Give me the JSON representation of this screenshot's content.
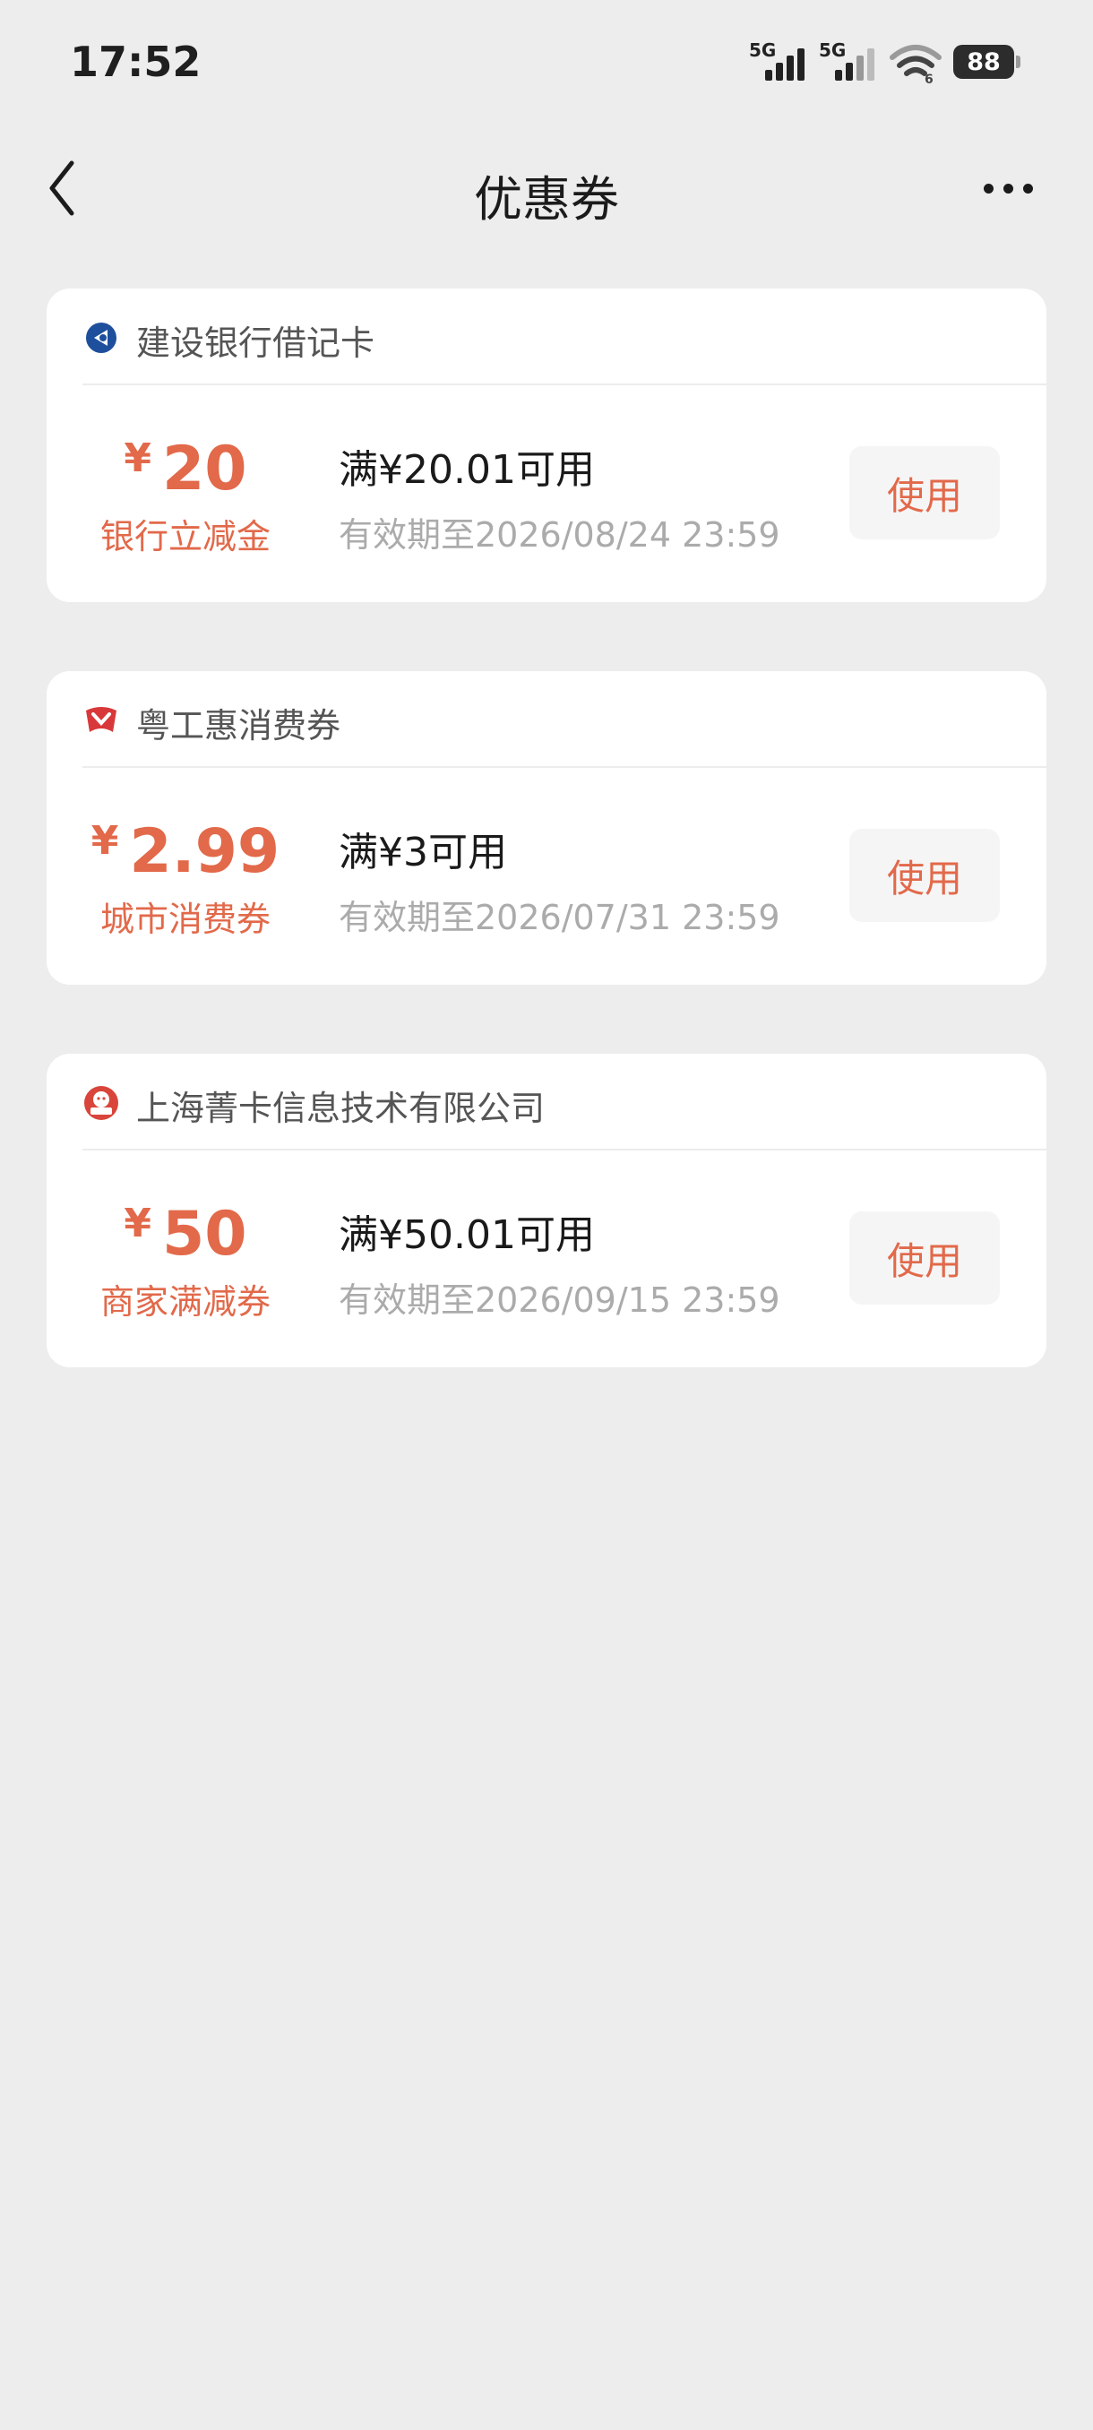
{
  "status_bar": {
    "time": "17:52",
    "signal_1_label": "5G",
    "signal_2_label": "5G",
    "battery": "88"
  },
  "nav": {
    "title": "优惠券",
    "back_icon": "chevron-left-icon",
    "more_icon": "more-horizontal-icon"
  },
  "colors": {
    "accent": "#e2694a",
    "background": "#ededed",
    "card": "#ffffff",
    "muted_text": "#ababab"
  },
  "coupons": [
    {
      "issuer": "建设银行借记卡",
      "issuer_icon": "ccb-logo-icon",
      "currency": "¥",
      "amount": "20",
      "type": "银行立减金",
      "threshold": "满¥20.01可用",
      "validity": "有效期至2026/08/24 23:59",
      "button": "使用"
    },
    {
      "issuer": "粤工惠消费券",
      "issuer_icon": "yuegonghui-logo-icon",
      "currency": "¥",
      "amount": "2.99",
      "type": "城市消费券",
      "threshold": "满¥3可用",
      "validity": "有效期至2026/07/31 23:59",
      "button": "使用"
    },
    {
      "issuer": "上海菁卡信息技术有限公司",
      "issuer_icon": "jingka-logo-icon",
      "currency": "¥",
      "amount": "50",
      "type": "商家满减券",
      "threshold": "满¥50.01可用",
      "validity": "有效期至2026/09/15 23:59",
      "button": "使用"
    }
  ]
}
